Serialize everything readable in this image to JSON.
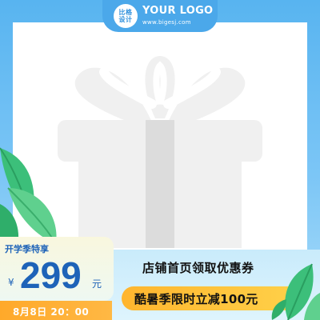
{
  "logo": {
    "badge_line1": "比格",
    "badge_line2": "设计",
    "title": "YOUR LOGO",
    "url": "www.bigesj.com"
  },
  "promo": {
    "label": "开学季特享",
    "currency": "¥",
    "price": "299",
    "unit": "元",
    "time": "8月8日 20：00"
  },
  "shop": {
    "text": "店铺首页领取优惠券",
    "discount": "酷暑季限时立减100元"
  },
  "colors": {
    "frame_blue": "#58b4f0",
    "price_blue": "#1e63b8",
    "accent_orange": "#ffa92a",
    "leaf_green": "#3cbf7a"
  },
  "icons": {
    "product": "gift-box-icon",
    "decor": "leaf-icon"
  }
}
